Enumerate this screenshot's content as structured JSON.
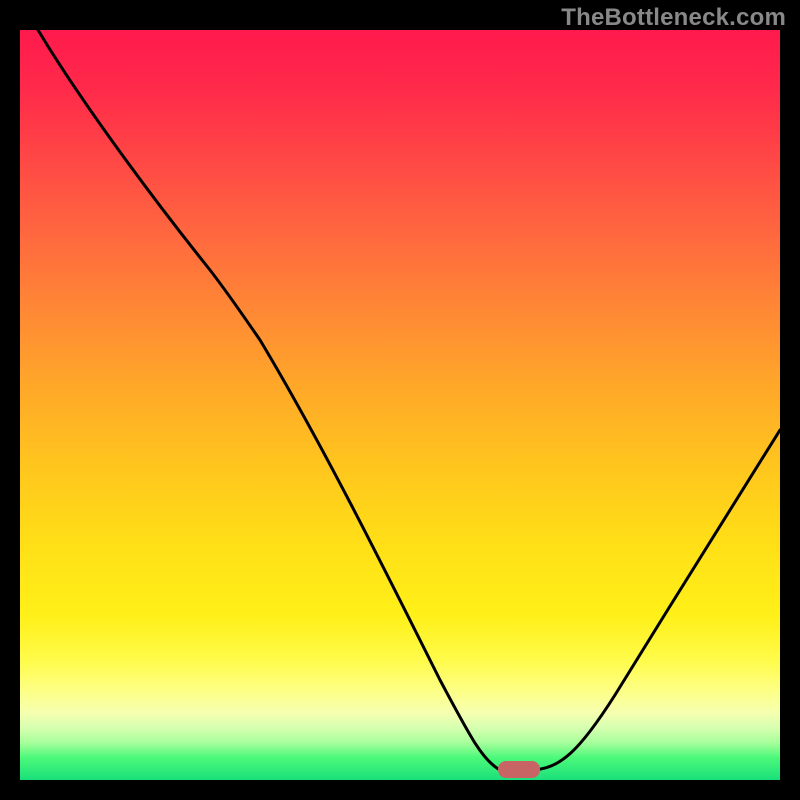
{
  "watermark": "TheBottleneck.com",
  "chart_data": {
    "type": "line",
    "title": "",
    "xlabel": "",
    "ylabel": "",
    "xlim": [
      0,
      100
    ],
    "ylim": [
      0,
      100
    ],
    "gradient_colors": {
      "top": "#ff1a4d",
      "mid": "#ffde17",
      "bottom": "#19e07a"
    },
    "marker": {
      "x": 66,
      "y": 1,
      "color": "#c86464"
    },
    "x": [
      0,
      5,
      10,
      15,
      20,
      25,
      30,
      35,
      40,
      45,
      50,
      55,
      60,
      65,
      70,
      75,
      80,
      85,
      90,
      95,
      100
    ],
    "values": [
      100,
      93,
      86,
      79,
      73,
      65,
      56,
      47,
      38,
      29,
      20,
      12,
      5,
      1,
      0,
      3,
      9,
      16,
      24,
      32,
      40
    ]
  }
}
